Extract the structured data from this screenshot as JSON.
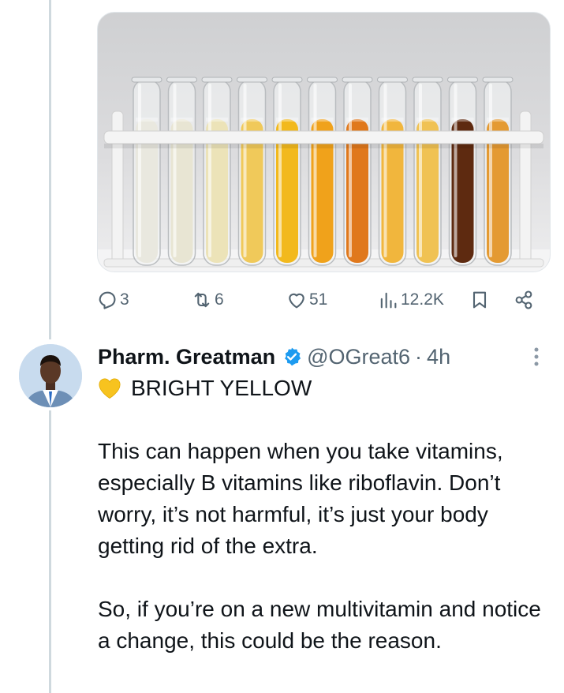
{
  "tweet_top": {
    "image_alt": "",
    "stats": {
      "replies": "3",
      "reposts": "6",
      "likes": "51",
      "views": "12.2K"
    }
  },
  "tweet": {
    "author_name": "Pharm. Greatman",
    "handle": "@OGreat6",
    "separator": "·",
    "time": "4h",
    "headline": "BRIGHT YELLOW",
    "paragraph1": "This can happen when you take vitamins, especially B vitamins like riboflavin. Don’t worry, it’s not harmful, it’s just your body getting rid of the extra.",
    "paragraph2": "So, if you’re on a new multivitamin and notice a change, this could be the reason."
  },
  "colors": {
    "accent": "#1d9bf0",
    "muted": "#536471",
    "heart_emoji": "#f5c100",
    "tube_liquids": [
      "#e9e8df",
      "#e8e5d3",
      "#ece3b8",
      "#f0c95a",
      "#f2b91d",
      "#f0a21b",
      "#e0781c",
      "#f1b63d",
      "#f0c253",
      "#5e2a10",
      "#e49a32"
    ]
  },
  "icons": [
    "reply-icon",
    "repost-icon",
    "like-icon",
    "views-icon",
    "bookmark-icon",
    "share-icon",
    "verified-icon",
    "more-icon",
    "yellow-heart-icon"
  ]
}
